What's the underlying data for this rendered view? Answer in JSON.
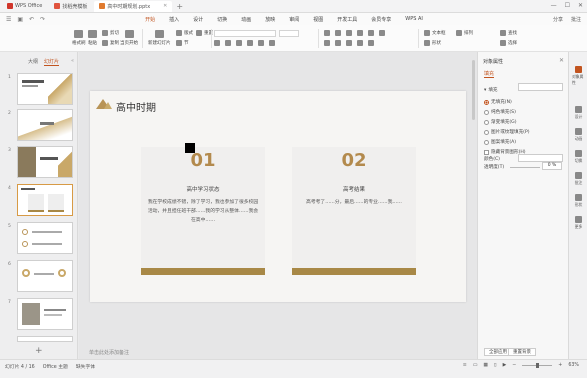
{
  "titlebar": {
    "tabs": [
      {
        "label": "WPS Office",
        "icon": "wps-logo-icon",
        "color": "#d0352b"
      },
      {
        "label": "找稻壳模板",
        "icon": "template-icon",
        "color": "#e0533e"
      },
      {
        "label": "高中时期规划.pptx",
        "icon": "ppt-file-icon",
        "color": "#e07a2e",
        "active": true
      }
    ]
  },
  "menu": {
    "left_icons": [
      "menu-icon",
      "save-icon",
      "undo-icon",
      "redo-icon"
    ],
    "items": [
      "开始",
      "插入",
      "设计",
      "切换",
      "动画",
      "放映",
      "审阅",
      "视图",
      "开发工具",
      "会员专享",
      "WPS AI"
    ],
    "active_index": 0,
    "right": [
      "分享",
      "批注"
    ]
  },
  "toolbar": {
    "buttons": [
      "格式刷",
      "粘贴",
      "剪切",
      "复制",
      "当页开始",
      "新建幻灯片",
      "版式",
      "节",
      "重置",
      "文本框",
      "形状",
      "排列",
      "查找",
      "选择"
    ]
  },
  "leftpanel": {
    "tabs": [
      "大纲",
      "幻灯片"
    ],
    "active_tab": 1,
    "slide_numbers": [
      "1",
      "2",
      "3",
      "4",
      "5",
      "6",
      "7"
    ],
    "selected_index": 3
  },
  "slide": {
    "title": "高中时期",
    "cards": [
      {
        "num": "01",
        "subtitle": "高中学习状态",
        "body": "我在学校成绩不错，除了学习，我也参加了很多校园活动，并且担任班干部……我的学习从整体……我会在高中……"
      },
      {
        "num": "02",
        "subtitle": "高考结果",
        "body": "高考考了……分，最后……的专业……我……"
      }
    ]
  },
  "notes_placeholder": "单击此处添加备注",
  "rightpanel": {
    "title": "对象属性",
    "tab": "填充",
    "section": "填充",
    "options": [
      "无填充(N)",
      "纯色填充(S)",
      "渐变填充(G)",
      "图片或纹理填充(P)",
      "图案填充(A)"
    ],
    "checkbox": "隐藏背景图形(H)",
    "color_label": "颜色(C)",
    "transparency_label": "透明度(T)",
    "transparency_value": "0 %",
    "apply_all": "全部应用",
    "reset": "重置背景"
  },
  "iconstrip": [
    "对象属性",
    "设计",
    "动画",
    "切换",
    "批注",
    "形状",
    "更多"
  ],
  "statusbar": {
    "left": [
      "幻灯片 4 / 16",
      "Office 主题",
      "缺失字体"
    ],
    "right_icons": [
      "notes-icon",
      "normal-view-icon",
      "sorter-view-icon",
      "reading-view-icon",
      "play-icon"
    ],
    "zoom": "63%"
  }
}
